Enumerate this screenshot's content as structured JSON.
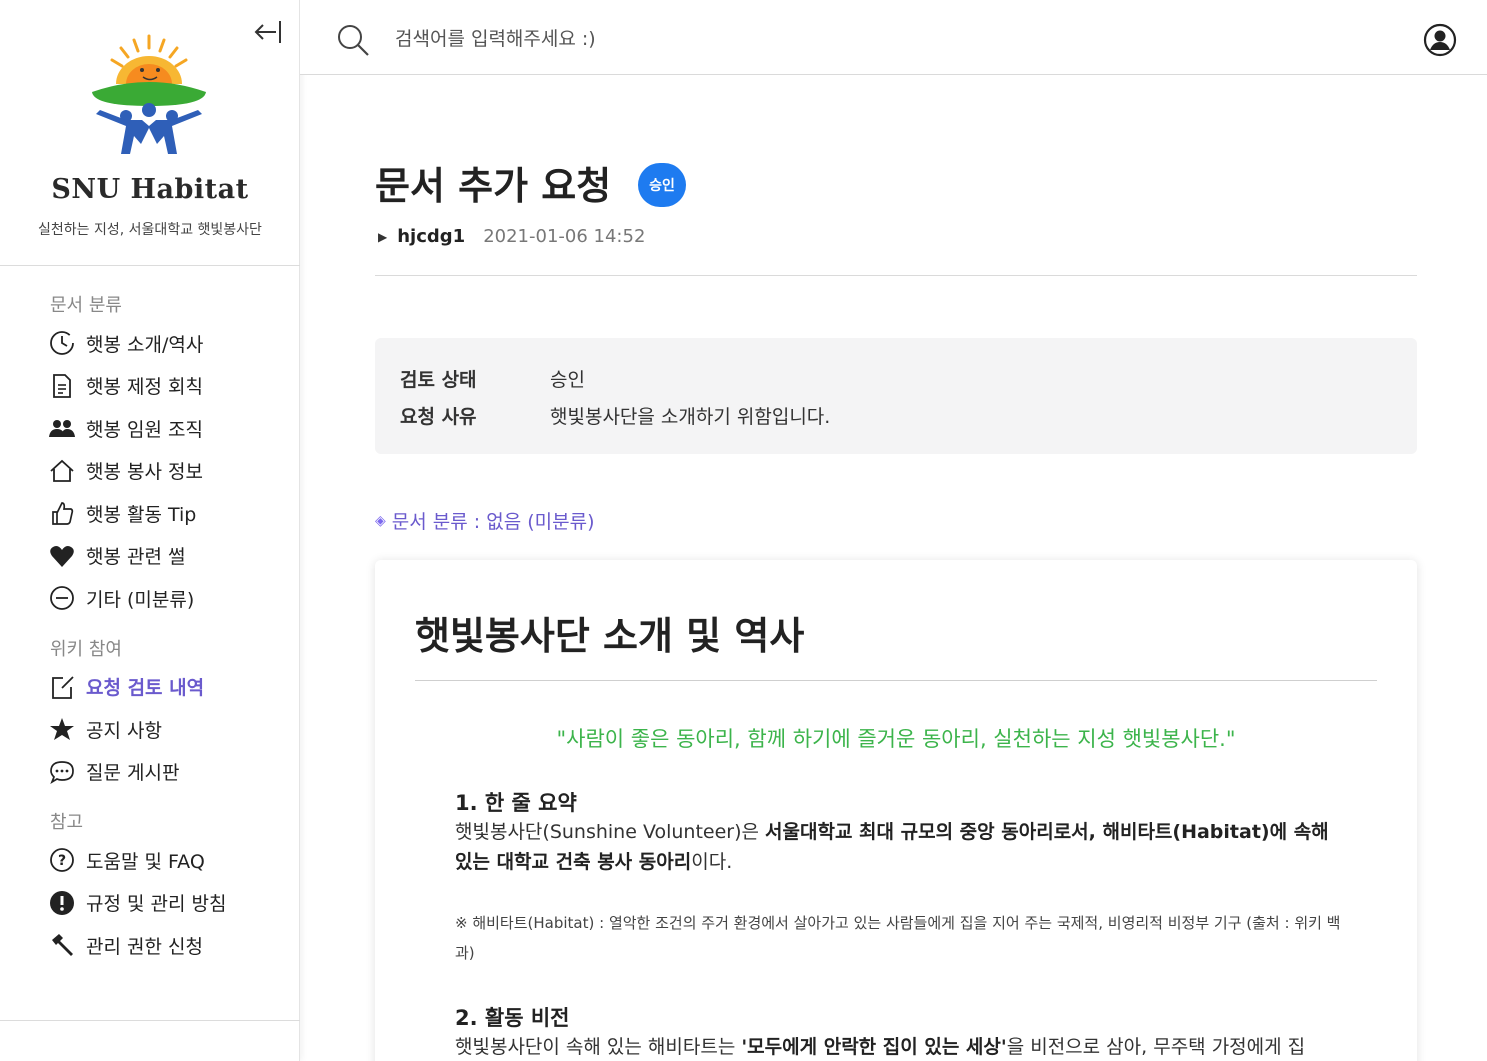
{
  "sidebar": {
    "brand": "SNU Habitat",
    "tagline": "실천하는 지성, 서울대학교 햇빛봉사단",
    "sections": [
      {
        "heading": "문서 분류",
        "items": [
          {
            "label": "햇봉 소개/역사",
            "icon": "clock-icon"
          },
          {
            "label": "햇봉 제정 회칙",
            "icon": "document-icon"
          },
          {
            "label": "햇봉 임원 조직",
            "icon": "people-icon"
          },
          {
            "label": "햇봉 봉사 정보",
            "icon": "home-icon"
          },
          {
            "label": "햇봉 활동 Tip",
            "icon": "thumbs-up-icon"
          },
          {
            "label": "햇봉 관련 썰",
            "icon": "heart-icon"
          },
          {
            "label": "기타 (미분류)",
            "icon": "minus-circle-icon"
          }
        ]
      },
      {
        "heading": "위키 참여",
        "items": [
          {
            "label": "요청 검토 내역",
            "icon": "edit-icon"
          },
          {
            "label": "공지 사항",
            "icon": "star-icon"
          },
          {
            "label": "질문 게시판",
            "icon": "chat-bubble-icon"
          }
        ]
      },
      {
        "heading": "참고",
        "items": [
          {
            "label": "도움말 및 FAQ",
            "icon": "question-circle-icon"
          },
          {
            "label": "규정 및 관리 방침",
            "icon": "exclamation-circle-icon"
          },
          {
            "label": "관리 권한 신청",
            "icon": "hammer-icon"
          }
        ]
      }
    ]
  },
  "search": {
    "placeholder": "검색어를 입력해주세요 :)"
  },
  "request": {
    "title": "문서 추가 요청",
    "status_badge": "승인",
    "author": "hjcdg1",
    "date": "2021-01-06 14:52",
    "review": {
      "status_label": "검토 상태",
      "status_value": "승인",
      "reason_label": "요청 사유",
      "reason_value": "햇빛봉사단을 소개하기 위함입니다."
    },
    "category": "문서 분류 : 없음 (미분류)"
  },
  "document": {
    "title": "햇빛봉사단 소개 및 역사",
    "quote": "\"사람이 좋은 동아리, 함께 하기에 즐거운 동아리, 실천하는 지성 햇빛봉사단.\"",
    "section1_title": "1. 한 줄 요약",
    "section1_p1": "햇빛봉사단(Sunshine Volunteer)은 ",
    "section1_b1": "서울대학교 최대 규모의 중앙 동아리로서, 해비타트(Habitat)에 속해 있는 대학교 건축 봉사 동아리",
    "section1_p2": "이다.",
    "section1_note": "※ 해비타트(Habitat) : 열악한 조건의 주거 환경에서 살아가고 있는 사람들에게 집을 지어 주는 국제적, 비영리적 비정부 기구 (출처 : 위키 백과)",
    "section2_title": "2. 활동 비전",
    "section2_p1": "햇빛봉사단이 속해 있는 해비타트는 ",
    "section2_b1": "'모두에게 안락한 집이 있는 세상'",
    "section2_p2": "을 비전으로 삼아, 무주택 가정에게 집"
  }
}
